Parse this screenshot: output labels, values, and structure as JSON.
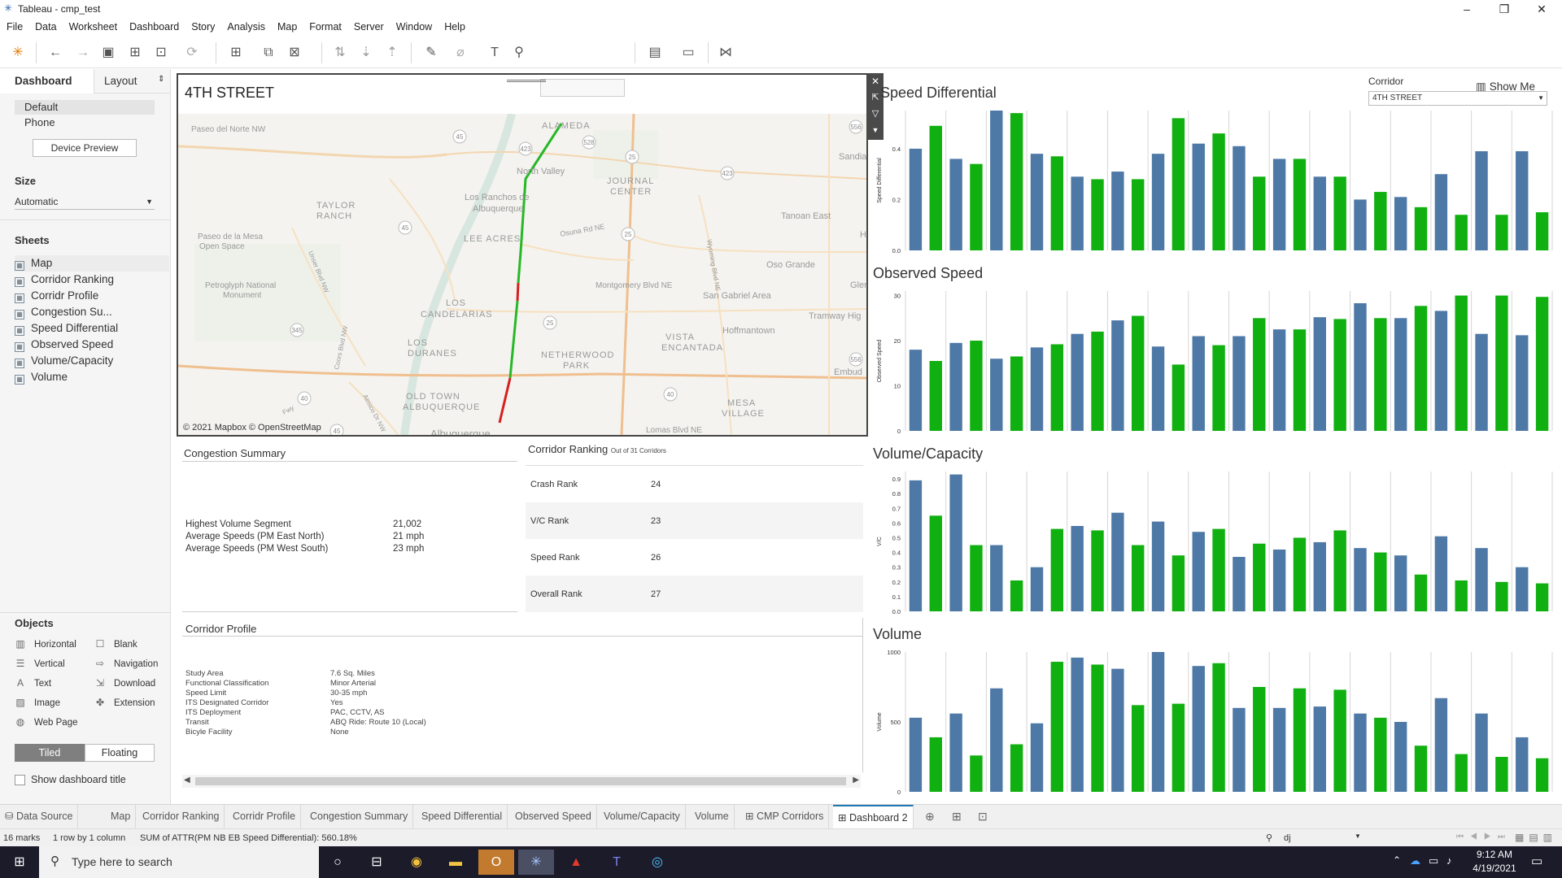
{
  "window": {
    "title": "Tableau - cmp_test",
    "minimize": "–",
    "maximize": "❐",
    "close": "✕"
  },
  "menu": [
    "File",
    "Data",
    "Worksheet",
    "Dashboard",
    "Story",
    "Analysis",
    "Map",
    "Format",
    "Server",
    "Window",
    "Help"
  ],
  "toolbar": {
    "show_me": "Show Me"
  },
  "left_panel": {
    "tabs": {
      "dashboard": "Dashboard",
      "layout": "Layout"
    },
    "device": {
      "default": "Default",
      "phone": "Phone",
      "preview_button": "Device Preview"
    },
    "size": {
      "heading": "Size",
      "value": "Automatic"
    },
    "sheets_heading": "Sheets",
    "sheets": [
      "Map",
      "Corridor Ranking",
      "Corridr Profile",
      "Congestion Su...",
      "Speed Differential",
      "Observed Speed",
      "Volume/Capacity",
      "Volume"
    ],
    "objects_heading": "Objects",
    "objects": [
      {
        "label": "Horizontal",
        "icon": "horizontal-icon"
      },
      {
        "label": "Blank",
        "icon": "blank-icon"
      },
      {
        "label": "Vertical",
        "icon": "vertical-icon"
      },
      {
        "label": "Navigation",
        "icon": "navigation-icon"
      },
      {
        "label": "Text",
        "icon": "text-icon"
      },
      {
        "label": "Download",
        "icon": "download-icon"
      },
      {
        "label": "Image",
        "icon": "image-icon"
      },
      {
        "label": "Extension",
        "icon": "extension-icon"
      },
      {
        "label": "Web Page",
        "icon": "web-page-icon"
      }
    ],
    "tiled": "Tiled",
    "floating": "Floating",
    "show_title": "Show dashboard title"
  },
  "map": {
    "title": "4TH STREET",
    "attribution": "© 2021 Mapbox © OpenStreetMap",
    "labels": [
      "Paseo del Norte NW",
      "ALAMEDA",
      "Sandia",
      "North Valley",
      "JOURNAL",
      "CENTER",
      "TAYLOR",
      "RANCH",
      "Los Ranchos de",
      "Albuquerque",
      "Tanoan East",
      "Paseo de la Mesa",
      "Open Space",
      "LEE ACRES",
      "Osuna Rd NE",
      "Oso Grande",
      "Petroglyph National",
      "Monument",
      "Montgomery Blvd NE",
      "San Gabriel Area",
      "Glen",
      "LOS",
      "CANDELARIAS",
      "Tramway Hig",
      "Hoffmantown",
      "LOS",
      "DURANES",
      "NETHERWOOD",
      "PARK",
      "VISTA",
      "ENCANTADA",
      "Embud",
      "OLD TOWN",
      "ALBUQUERQUE",
      "MESA",
      "VILLAGE",
      "Lomas Blvd NE",
      "Albuquerque",
      "Unser Blvd NW",
      "Coors Blvd NW",
      "Wyoming Blvd NE",
      "Atrisco Dr NW",
      "Fwy",
      "H"
    ],
    "shields": [
      "45",
      "423",
      "528",
      "25",
      "556",
      "423",
      "45",
      "25",
      "345",
      "25",
      "556",
      "40",
      "40",
      "45"
    ]
  },
  "congestion": {
    "title": "Congestion Summary",
    "rows": [
      {
        "label": "Highest Volume Segment",
        "value": "21,002"
      },
      {
        "label": "Average Speeds (PM East North)",
        "value": "21 mph"
      },
      {
        "label": "Average Speeds (PM West South)",
        "value": "23 mph"
      }
    ]
  },
  "ranking": {
    "title": "Corridor Ranking",
    "subtitle": "Out of 31 Corridors",
    "rows": [
      {
        "label": "Crash Rank",
        "value": "24"
      },
      {
        "label": "V/C Rank",
        "value": "23"
      },
      {
        "label": "Speed Rank",
        "value": "26"
      },
      {
        "label": "Overall Rank",
        "value": "27"
      }
    ]
  },
  "profile": {
    "title": "Corridor Profile",
    "rows": [
      {
        "label": "Study Area",
        "value": "7.6 Sq. Miles"
      },
      {
        "label": "Functional Classification",
        "value": "Minor Arterial"
      },
      {
        "label": "Speed Limit",
        "value": "30-35 mph"
      },
      {
        "label": "ITS Designated Corridor",
        "value": "Yes"
      },
      {
        "label": "ITS Deployment",
        "value": "PAC, CCTV, AS"
      },
      {
        "label": "Transit",
        "value": "ABQ Ride: Route 10 (Local)"
      },
      {
        "label": "Bicyle Facility",
        "value": "None"
      }
    ]
  },
  "filter": {
    "label": "Corridor",
    "value": "4TH STREET"
  },
  "colors": {
    "blue": "#4e79a7",
    "green": "#0fb00f",
    "route_green": "#27b827",
    "route_red": "#d62020"
  },
  "chart_data": [
    {
      "type": "bar",
      "title": "Speed Differential",
      "ylabel": "Speed Differential",
      "ylim": [
        0,
        0.55
      ],
      "yticks": [
        "0.0",
        "0.2",
        "0.4"
      ],
      "ytick_values": [
        0,
        0.2,
        0.4
      ],
      "grid": true,
      "values": [
        0.4,
        0.49,
        0.36,
        0.34,
        0.55,
        0.54,
        0.38,
        0.37,
        0.29,
        0.28,
        0.31,
        0.28,
        0.38,
        0.52,
        0.42,
        0.46,
        0.41,
        0.29,
        0.36,
        0.36,
        0.29,
        0.29,
        0.2,
        0.23,
        0.21,
        0.17,
        0.3,
        0.14,
        0.39,
        0.14,
        0.39,
        0.15
      ]
    },
    {
      "type": "bar",
      "title": "Observed Speed",
      "ylabel": "Observed Speed",
      "ylim": [
        0,
        31
      ],
      "yticks": [
        "0",
        "10",
        "20",
        "30"
      ],
      "ytick_values": [
        0,
        10,
        20,
        30
      ],
      "grid": true,
      "values": [
        18,
        15.5,
        19.5,
        20,
        16,
        16.5,
        18.5,
        19.2,
        21.5,
        22,
        24.5,
        25.5,
        18.7,
        14.7,
        21,
        19,
        21,
        25,
        22.5,
        22.5,
        25.2,
        24.8,
        28.3,
        25,
        25,
        27.7,
        26.6,
        30,
        21.5,
        30,
        21.2,
        29.7
      ]
    },
    {
      "type": "bar",
      "title": "Volume/Capacity",
      "ylabel": "V/C",
      "ylim": [
        0,
        0.95
      ],
      "yticks": [
        "0.0",
        "0.1",
        "0.2",
        "0.3",
        "0.4",
        "0.5",
        "0.6",
        "0.7",
        "0.8",
        "0.9"
      ],
      "ytick_values": [
        0,
        0.1,
        0.2,
        0.3,
        0.4,
        0.5,
        0.6,
        0.7,
        0.8,
        0.9
      ],
      "grid": true,
      "values": [
        0.89,
        0.65,
        0.93,
        0.45,
        0.45,
        0.21,
        0.3,
        0.56,
        0.58,
        0.55,
        0.67,
        0.45,
        0.61,
        0.38,
        0.54,
        0.56,
        0.37,
        0.46,
        0.42,
        0.5,
        0.47,
        0.55,
        0.43,
        0.4,
        0.38,
        0.25,
        0.51,
        0.21,
        0.43,
        0.2,
        0.3,
        0.19
      ]
    },
    {
      "type": "bar",
      "title": "Volume",
      "ylabel": "Volume",
      "ylim": [
        0,
        1000
      ],
      "yticks": [
        "0",
        "500",
        "1000"
      ],
      "ytick_values": [
        0,
        500,
        1000
      ],
      "grid": true,
      "values": [
        530,
        390,
        560,
        260,
        740,
        340,
        490,
        930,
        960,
        910,
        880,
        620,
        1000,
        630,
        900,
        920,
        600,
        750,
        600,
        740,
        610,
        730,
        560,
        530,
        500,
        330,
        670,
        270,
        560,
        250,
        390,
        240
      ]
    }
  ],
  "sheet_tabs": [
    "Data Source",
    "Map",
    "Corridor Ranking",
    "Corridr Profile",
    "Congestion Summary",
    "Speed Differential",
    "Observed Speed",
    "Volume/Capacity",
    "Volume",
    "CMP Corridors",
    "Dashboard 2"
  ],
  "status": {
    "marks": "16 marks",
    "rows": "1 row by 1 column",
    "sum": "SUM of ATTR(PM NB EB Speed Differential): 560.18%",
    "user": "dj"
  },
  "taskbar": {
    "search": "Type here to search",
    "time": "9:12 AM",
    "date": "4/19/2021"
  }
}
